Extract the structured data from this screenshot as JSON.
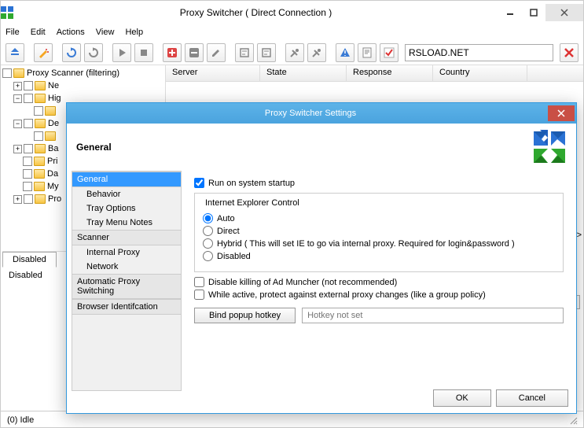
{
  "window": {
    "title": "Proxy Switcher  ( Direct Connection )"
  },
  "menu": [
    "File",
    "Edit",
    "Actions",
    "View",
    "Help"
  ],
  "url_value": "RSLOAD.NET",
  "tree": {
    "root": "Proxy Scanner (filtering)",
    "items": [
      "Ne",
      "Hig",
      "",
      "De",
      "",
      "Ba",
      "Pri",
      "Da",
      "My",
      "Pro"
    ]
  },
  "list_columns": {
    "server": "Server",
    "state": "State",
    "response": "Response",
    "country": "Country"
  },
  "tabs": {
    "disabled_tab": "Disabled",
    "disabled_label": "Disabled"
  },
  "status": "(0)  Idle",
  "dialog": {
    "title": "Proxy Switcher Settings",
    "header": "General",
    "nav": {
      "general": "General",
      "behavior": "Behavior",
      "tray_options": "Tray Options",
      "tray_menu_notes": "Tray Menu Notes",
      "scanner": "Scanner",
      "internal_proxy": "Internal Proxy",
      "network": "Network",
      "auto_switch": "Automatic Proxy Switching",
      "browser_id": "Browser Identifcation"
    },
    "form": {
      "run_startup": "Run on system startup",
      "ie_control": "Internet Explorer Control",
      "auto": "Auto",
      "direct": "Direct",
      "hybrid": "Hybrid ( This will set IE to go via internal proxy. Required for login&password )",
      "disabled": "Disabled",
      "disable_admuncher": "Disable killing of Ad Muncher (not recommended)",
      "protect_changes": "While active, protect against external proxy changes (like a group policy)",
      "bind_hotkey": "Bind popup hotkey",
      "hotkey_placeholder": "Hotkey not set"
    },
    "ok": "OK",
    "cancel": "Cancel"
  }
}
